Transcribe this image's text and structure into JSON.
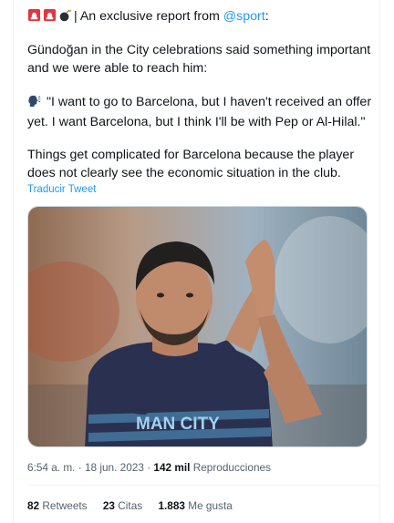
{
  "tweet": {
    "intro_separator": "|",
    "intro_text": " An exclusive report from ",
    "mention": "@sport",
    "intro_end": ":",
    "para2": "Gündoğan in the City celebrations said something important and we were able to reach him:",
    "para3": "\"I want to go to Barcelona, but I haven't received an offer yet. I want Barcelona, but I think I'll be with Pep or Al-Hilal.\"",
    "para4": "Things get complicated for Barcelona because the player does not clearly see the economic situation in the club.",
    "translate_label": "Traducir Tweet"
  },
  "icons": {
    "siren_1": "police-siren-icon",
    "siren_2": "police-siren-icon",
    "bomb": "bomb-icon",
    "speaker": "speaking-head-icon"
  },
  "media": {
    "jersey_text": "MAN CITY"
  },
  "meta": {
    "time": "6:54 a. m.",
    "separator": "·",
    "date": "18 jun. 2023",
    "views_count": "142 mil",
    "views_label": "Reproducciones"
  },
  "stats": {
    "retweets_count": "82",
    "retweets_label": "Retweets",
    "quotes_count": "23",
    "quotes_label": "Citas",
    "likes_count": "1.883",
    "likes_label": "Me gusta"
  },
  "colors": {
    "accent": "#1d9bf0",
    "text": "#0f1419",
    "muted": "#536471",
    "siren_red": "#e0373f"
  }
}
